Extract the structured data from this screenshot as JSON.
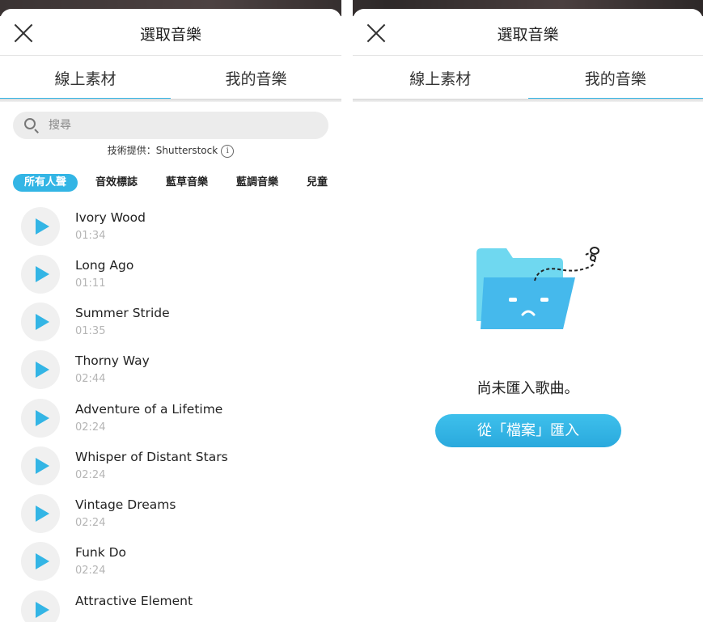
{
  "left": {
    "header": {
      "title": "選取音樂"
    },
    "tabs": [
      {
        "label": "線上素材"
      },
      {
        "label": "我的音樂"
      }
    ],
    "search": {
      "placeholder": "搜尋"
    },
    "credit": "技術提供：Shutterstock",
    "categories": [
      "所有人聲",
      "音效標誌",
      "藍草音樂",
      "藍調音樂",
      "兒童"
    ],
    "songs": [
      {
        "title": "Ivory Wood",
        "duration": "01:34"
      },
      {
        "title": "Long Ago",
        "duration": "01:11"
      },
      {
        "title": "Summer Stride",
        "duration": "01:35"
      },
      {
        "title": "Thorny Way",
        "duration": "02:44"
      },
      {
        "title": "Adventure of a Lifetime",
        "duration": "02:24"
      },
      {
        "title": "Whisper of Distant Stars",
        "duration": "02:24"
      },
      {
        "title": "Vintage Dreams",
        "duration": "02:24"
      },
      {
        "title": "Funk Do",
        "duration": "02:24"
      },
      {
        "title": "Attractive Element",
        "duration": ""
      }
    ]
  },
  "right": {
    "header": {
      "title": "選取音樂"
    },
    "tabs": [
      {
        "label": "線上素材"
      },
      {
        "label": "我的音樂"
      }
    ],
    "empty_message": "尚未匯入歌曲。",
    "import_button": "從「檔案」匯入"
  },
  "colors": {
    "accent": "#33b5e5",
    "folder_back": "#6fd8f0",
    "folder_front": "#45b9ec",
    "duration_gray": "#b5b5b5"
  },
  "icons": {
    "close": "close-icon",
    "search": "search-icon",
    "info": "info-icon",
    "play": "play-icon",
    "folder": "sad-folder-icon"
  }
}
